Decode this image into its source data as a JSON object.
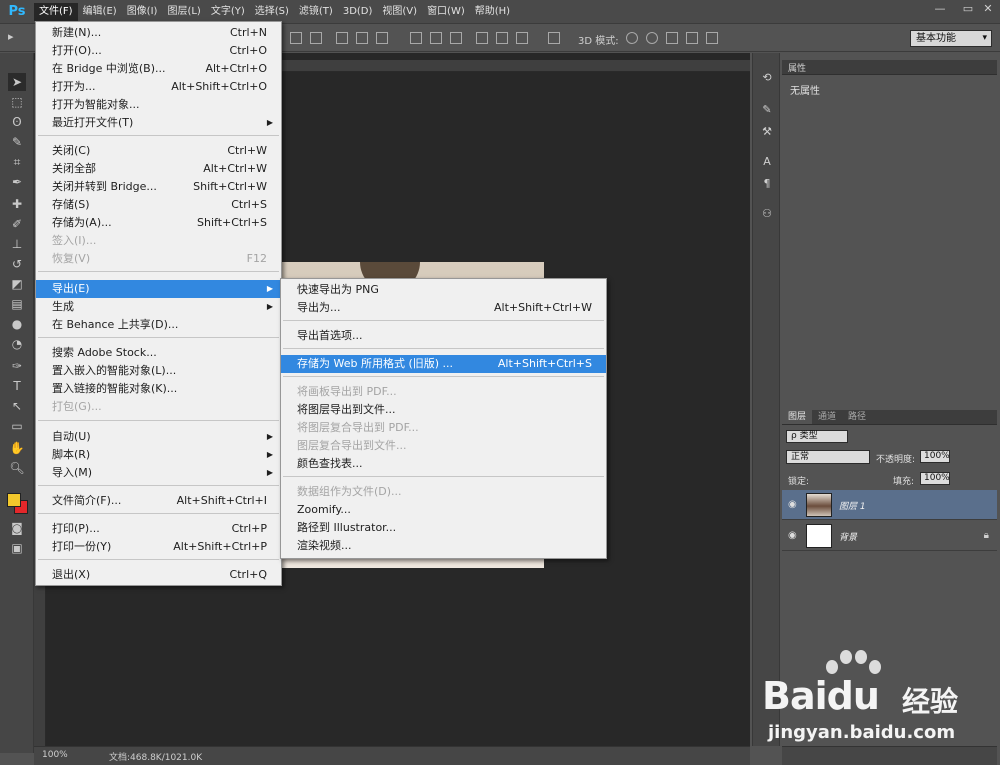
{
  "app": {
    "logo": "Ps"
  },
  "menubar": {
    "items": [
      "文件(F)",
      "编辑(E)",
      "图像(I)",
      "图层(L)",
      "文字(Y)",
      "选择(S)",
      "滤镜(T)",
      "3D(D)",
      "视图(V)",
      "窗口(W)",
      "帮助(H)"
    ],
    "active_index": 0
  },
  "window_controls": {
    "minimize": "—",
    "restore": "▭",
    "close": "✕"
  },
  "options_bar": {
    "mode_3d_label": "3D 模式:",
    "workspace": "基本功能"
  },
  "colors": {
    "foreground": "#f3c82c",
    "background": "#e3272a",
    "highlight": "#3288e0",
    "selected_layer": "#5a6f8c"
  },
  "file_menu": {
    "items": [
      {
        "label": "新建(N)...",
        "shortcut": "Ctrl+N",
        "disabled": false
      },
      {
        "label": "打开(O)...",
        "shortcut": "Ctrl+O",
        "disabled": false
      },
      {
        "label": "在 Bridge 中浏览(B)...",
        "shortcut": "Alt+Ctrl+O",
        "disabled": false
      },
      {
        "label": "打开为...",
        "shortcut": "Alt+Shift+Ctrl+O",
        "disabled": false
      },
      {
        "label": "打开为智能对象...",
        "shortcut": "",
        "disabled": false
      },
      {
        "label": "最近打开文件(T)",
        "shortcut": "",
        "submenu": true,
        "disabled": false
      },
      {
        "label": "关闭(C)",
        "shortcut": "Ctrl+W",
        "disabled": false
      },
      {
        "label": "关闭全部",
        "shortcut": "Alt+Ctrl+W",
        "disabled": false
      },
      {
        "label": "关闭并转到 Bridge...",
        "shortcut": "Shift+Ctrl+W",
        "disabled": false
      },
      {
        "label": "存储(S)",
        "shortcut": "Ctrl+S",
        "disabled": false
      },
      {
        "label": "存储为(A)...",
        "shortcut": "Shift+Ctrl+S",
        "disabled": false
      },
      {
        "label": "签入(I)...",
        "shortcut": "",
        "disabled": true
      },
      {
        "label": "恢复(V)",
        "shortcut": "F12",
        "disabled": true
      },
      {
        "label": "导出(E)",
        "shortcut": "",
        "submenu": true,
        "highlighted": true,
        "disabled": false
      },
      {
        "label": "生成",
        "shortcut": "",
        "submenu": true,
        "disabled": false
      },
      {
        "label": "在 Behance 上共享(D)...",
        "shortcut": "",
        "disabled": false
      },
      {
        "label": "搜索 Adobe Stock...",
        "shortcut": "",
        "disabled": false
      },
      {
        "label": "置入嵌入的智能对象(L)...",
        "shortcut": "",
        "disabled": false
      },
      {
        "label": "置入链接的智能对象(K)...",
        "shortcut": "",
        "disabled": false
      },
      {
        "label": "打包(G)...",
        "shortcut": "",
        "disabled": true
      },
      {
        "label": "自动(U)",
        "shortcut": "",
        "submenu": true,
        "disabled": false
      },
      {
        "label": "脚本(R)",
        "shortcut": "",
        "submenu": true,
        "disabled": false
      },
      {
        "label": "导入(M)",
        "shortcut": "",
        "submenu": true,
        "disabled": false
      },
      {
        "label": "文件简介(F)...",
        "shortcut": "Alt+Shift+Ctrl+I",
        "disabled": false
      },
      {
        "label": "打印(P)...",
        "shortcut": "Ctrl+P",
        "disabled": false
      },
      {
        "label": "打印一份(Y)",
        "shortcut": "Alt+Shift+Ctrl+P",
        "disabled": false
      },
      {
        "label": "退出(X)",
        "shortcut": "Ctrl+Q",
        "disabled": false
      }
    ]
  },
  "export_menu": {
    "items": [
      {
        "label": "快速导出为 PNG",
        "shortcut": "",
        "disabled": false
      },
      {
        "label": "导出为...",
        "shortcut": "Alt+Shift+Ctrl+W",
        "disabled": false
      },
      {
        "label": "导出首选项...",
        "shortcut": "",
        "disabled": false
      },
      {
        "label": "存储为 Web 所用格式 (旧版) ...",
        "shortcut": "Alt+Shift+Ctrl+S",
        "highlighted": true,
        "disabled": false
      },
      {
        "label": "将画板导出到 PDF...",
        "shortcut": "",
        "disabled": true
      },
      {
        "label": "将图层导出到文件...",
        "shortcut": "",
        "disabled": false
      },
      {
        "label": "将图层复合导出到 PDF...",
        "shortcut": "",
        "disabled": true
      },
      {
        "label": "图层复合导出到文件...",
        "shortcut": "",
        "disabled": true
      },
      {
        "label": "颜色查找表...",
        "shortcut": "",
        "disabled": false
      },
      {
        "label": "数据组作为文件(D)...",
        "shortcut": "",
        "disabled": true
      },
      {
        "label": "Zoomify...",
        "shortcut": "",
        "disabled": false
      },
      {
        "label": "路径到 Illustrator...",
        "shortcut": "",
        "disabled": false
      },
      {
        "label": "渲染视频...",
        "shortcut": "",
        "disabled": false
      }
    ]
  },
  "properties_panel": {
    "tab": "属性",
    "empty_text": "无属性"
  },
  "layers_panel": {
    "tabs": [
      "图层",
      "通道",
      "路径"
    ],
    "active_tab": 0,
    "filter": "ρ 类型",
    "blend_mode": "正常",
    "opacity_label": "不透明度:",
    "opacity": "100%",
    "lock_label": "锁定:",
    "fill_label": "填充:",
    "fill": "100%",
    "layers": [
      {
        "name": "图层 1",
        "selected": true
      },
      {
        "name": "背景",
        "selected": false,
        "locked": true
      }
    ]
  },
  "status_bar": {
    "zoom": "100%",
    "doc_size": "文档:468.8K/1021.0K"
  },
  "watermark": {
    "logo": "Baidu",
    "sub": "经验",
    "url": "jingyan.baidu.com"
  }
}
